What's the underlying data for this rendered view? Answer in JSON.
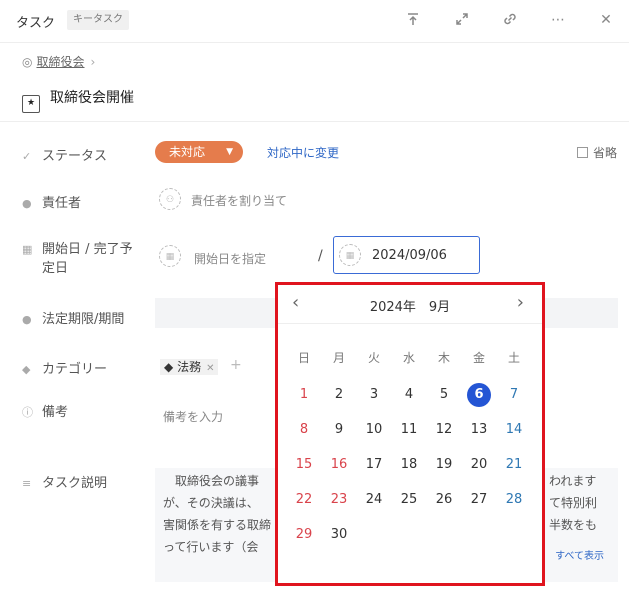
{
  "header": {
    "title": "タスク",
    "badge": "キータスク",
    "icons": [
      "collapse-up-icon",
      "expand-icon",
      "link-icon",
      "more-icon",
      "close-icon"
    ]
  },
  "breadcrumb": {
    "parent": "取締役会"
  },
  "task": {
    "title": "取締役会開催"
  },
  "fields": {
    "status": {
      "label": "ステータス",
      "value": "未対応",
      "action": "対応中に変更",
      "omit_label": "省略"
    },
    "owner": {
      "label": "責任者",
      "placeholder": "責任者を割り当て"
    },
    "dates": {
      "label_line1": "開始日 / 完了予",
      "label_line2": "定日",
      "start_placeholder": "開始日を指定",
      "separator": "/",
      "due_value": "2024/09/06"
    },
    "legal_deadline": {
      "label": "法定期限/期間"
    },
    "category": {
      "label": "カテゴリー",
      "tag": "法務"
    },
    "remarks": {
      "label": "備考",
      "placeholder": "備考を入力"
    },
    "description": {
      "label": "タスク説明",
      "lines": [
        "　取締役会の議事",
        "が、その決議は、",
        "害関係を有する取締",
        "って行います（会"
      ],
      "line_tails": [
        "われます",
        "て特別利",
        "半数をも",
        ""
      ],
      "show_all": "すべて表示"
    }
  },
  "calendar": {
    "month_title": "2024年　9月",
    "weekdays": [
      "日",
      "月",
      "火",
      "水",
      "木",
      "金",
      "土"
    ],
    "weeks": [
      [
        "1",
        "2",
        "3",
        "4",
        "5",
        "6",
        "7"
      ],
      [
        "8",
        "9",
        "10",
        "11",
        "12",
        "13",
        "14"
      ],
      [
        "15",
        "16",
        "17",
        "18",
        "19",
        "20",
        "21"
      ],
      [
        "22",
        "23",
        "24",
        "25",
        "26",
        "27",
        "28"
      ],
      [
        "29",
        "30",
        "",
        "",
        "",
        "",
        ""
      ]
    ],
    "selected": "6",
    "holidays": [
      "16",
      "23"
    ],
    "colors": {
      "sunday": "#d9434b",
      "saturday": "#2f78b3",
      "selected": "#2455d4",
      "highlight_border": "#e0141e"
    }
  }
}
